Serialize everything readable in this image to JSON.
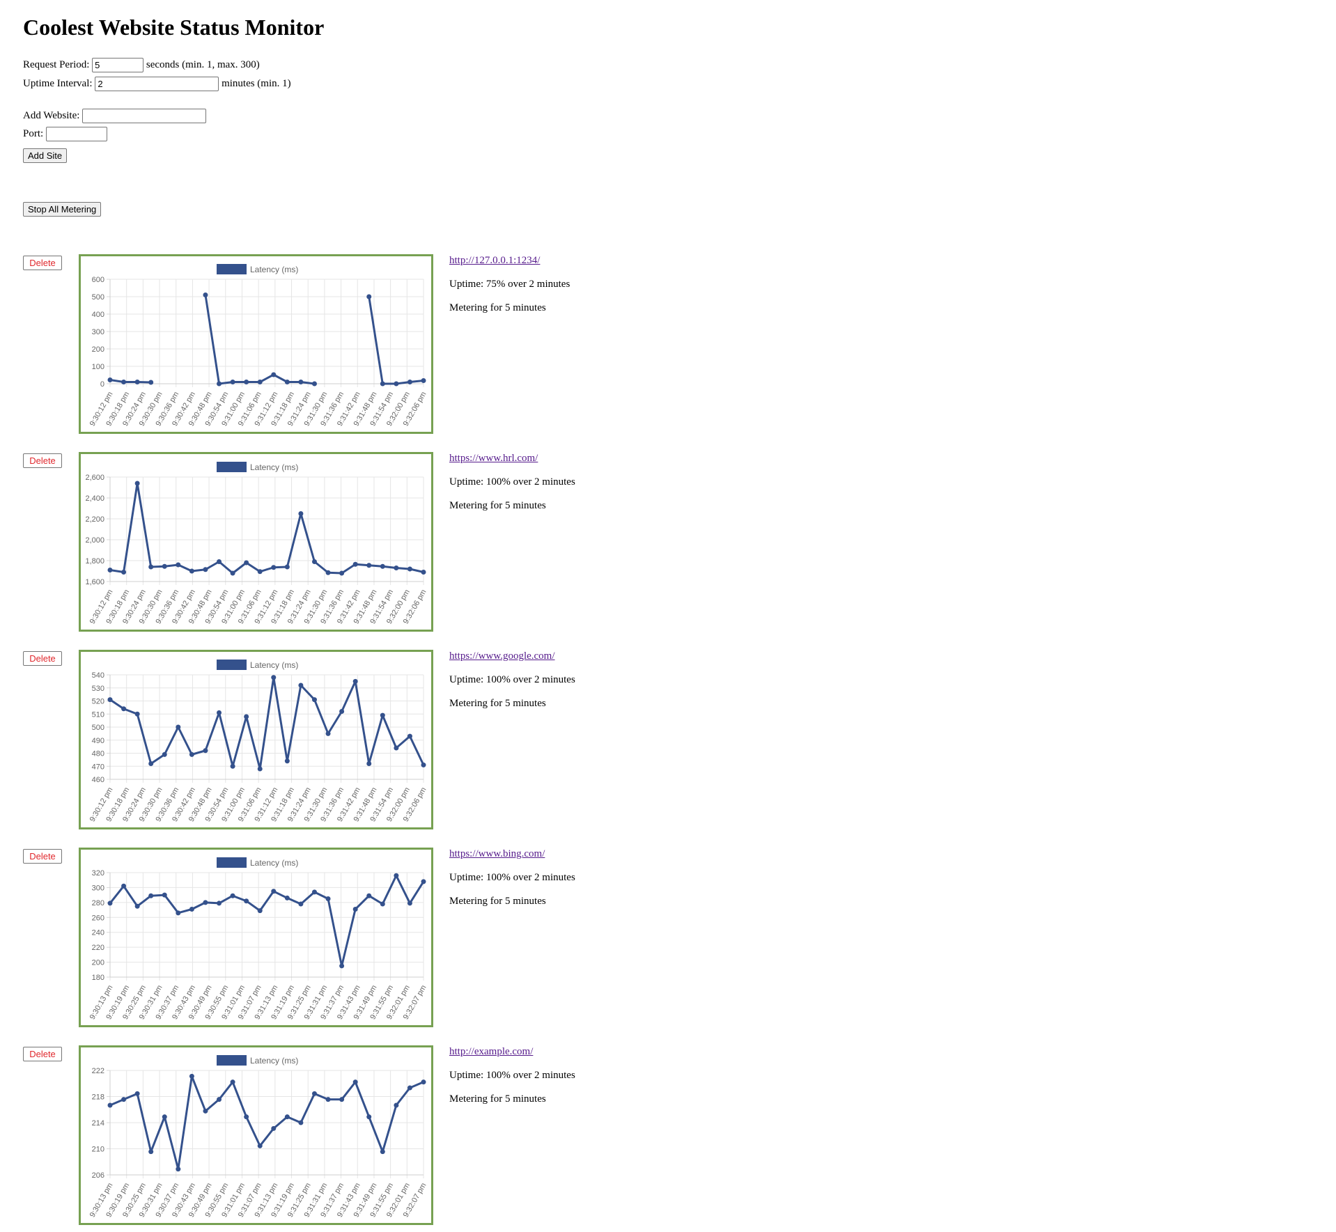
{
  "title": "Coolest Website Status Monitor",
  "settings": {
    "request_period_label": "Request Period:",
    "request_period_value": "5",
    "request_period_suffix": "seconds (min. 1, max. 300)",
    "uptime_interval_label": "Uptime Interval:",
    "uptime_interval_value": "2",
    "uptime_interval_suffix": "minutes (min. 1)"
  },
  "add_form": {
    "website_label": "Add Website:",
    "website_value": "",
    "port_label": "Port:",
    "port_value": "",
    "add_button": "Add Site"
  },
  "stop_button": "Stop All Metering",
  "colors": {
    "series": "#34518c",
    "chart_border": "#77a152",
    "delete_text": "#e0272c",
    "link": "#551a8b"
  },
  "sites": [
    {
      "delete_label": "Delete",
      "url": "http://127.0.0.1:1234/",
      "uptime": "Uptime: 75% over 2 minutes",
      "metering": "Metering for 5 minutes"
    },
    {
      "delete_label": "Delete",
      "url": "https://www.hrl.com/",
      "uptime": "Uptime: 100% over 2 minutes",
      "metering": "Metering for 5 minutes"
    },
    {
      "delete_label": "Delete",
      "url": "https://www.google.com/",
      "uptime": "Uptime: 100% over 2 minutes",
      "metering": "Metering for 5 minutes"
    },
    {
      "delete_label": "Delete",
      "url": "https://www.bing.com/",
      "uptime": "Uptime: 100% over 2 minutes",
      "metering": "Metering for 5 minutes"
    },
    {
      "delete_label": "Delete",
      "url": "http://example.com/",
      "uptime": "Uptime: 100% over 2 minutes",
      "metering": "Metering for 5 minutes"
    }
  ],
  "chart_data": [
    {
      "type": "line",
      "legend": [
        "Latency (ms)"
      ],
      "ylim": [
        0,
        600
      ],
      "yticks": [
        "600",
        "500",
        "400",
        "300",
        "200",
        "100",
        "0"
      ],
      "categories": [
        "9:30:12 pm",
        "9:30:18 pm",
        "9:30:24 pm",
        "9:30:30 pm",
        "9:30:36 pm",
        "9:30:42 pm",
        "9:30:48 pm",
        "9:30:54 pm",
        "9:31:00 pm",
        "9:31:06 pm",
        "9:31:12 pm",
        "9:31:18 pm",
        "9:31:24 pm",
        "9:31:30 pm",
        "9:31:36 pm",
        "9:31:42 pm",
        "9:31:48 pm",
        "9:31:54 pm",
        "9:32:00 pm",
        "9:32:06 pm"
      ],
      "values": [
        22,
        10,
        10,
        8,
        null,
        null,
        null,
        510,
        0,
        10,
        10,
        10,
        52,
        10,
        10,
        0,
        null,
        null,
        null,
        500,
        0,
        0,
        10,
        18
      ],
      "series": [
        {
          "name": "Latency (ms)",
          "values": [
            22,
            10,
            10,
            8,
            null,
            null,
            null,
            510,
            0,
            10,
            10,
            10,
            52,
            10,
            10,
            0,
            null,
            null,
            null,
            500,
            0,
            0,
            10,
            18
          ]
        }
      ]
    },
    {
      "type": "line",
      "legend": [
        "Latency (ms)"
      ],
      "ylim": [
        1600,
        2600
      ],
      "yticks": [
        "2,600",
        "2,400",
        "2,200",
        "2,000",
        "1,800",
        "1,600"
      ],
      "categories": [
        "9:30:12 pm",
        "9:30:18 pm",
        "9:30:24 pm",
        "9:30:30 pm",
        "9:30:36 pm",
        "9:30:42 pm",
        "9:30:48 pm",
        "9:30:54 pm",
        "9:31:00 pm",
        "9:31:06 pm",
        "9:31:12 pm",
        "9:31:18 pm",
        "9:31:24 pm",
        "9:31:30 pm",
        "9:31:36 pm",
        "9:31:42 pm",
        "9:31:48 pm",
        "9:31:54 pm",
        "9:32:00 pm",
        "9:32:06 pm"
      ],
      "values": [
        1710,
        1690,
        2540,
        1740,
        1745,
        1760,
        1700,
        1715,
        1790,
        1680,
        1780,
        1695,
        1735,
        1740,
        2250,
        1790,
        1685,
        1680,
        1765,
        1755,
        1745,
        1730,
        1720,
        1690
      ],
      "series": [
        {
          "name": "Latency (ms)",
          "values": [
            1710,
            1690,
            2540,
            1740,
            1745,
            1760,
            1700,
            1715,
            1790,
            1680,
            1780,
            1695,
            1735,
            1740,
            2250,
            1790,
            1685,
            1680,
            1765,
            1755,
            1745,
            1730,
            1720,
            1690
          ]
        }
      ]
    },
    {
      "type": "line",
      "legend": [
        "Latency (ms)"
      ],
      "ylim": [
        460,
        540
      ],
      "yticks": [
        "540",
        "530",
        "520",
        "510",
        "500",
        "490",
        "480",
        "470",
        "460"
      ],
      "categories": [
        "9:30:12 pm",
        "9:30:18 pm",
        "9:30:24 pm",
        "9:30:30 pm",
        "9:30:36 pm",
        "9:30:42 pm",
        "9:30:48 pm",
        "9:30:54 pm",
        "9:31:00 pm",
        "9:31:06 pm",
        "9:31:12 pm",
        "9:31:18 pm",
        "9:31:24 pm",
        "9:31:30 pm",
        "9:31:36 pm",
        "9:31:42 pm",
        "9:31:48 pm",
        "9:31:54 pm",
        "9:32:00 pm",
        "9:32:06 pm"
      ],
      "values": [
        521,
        514,
        510,
        472,
        479,
        500,
        479,
        482,
        511,
        470,
        508,
        468,
        538,
        474,
        532,
        521,
        495,
        512,
        535,
        472,
        509,
        484,
        493,
        471
      ],
      "series": [
        {
          "name": "Latency (ms)",
          "values": [
            521,
            514,
            510,
            472,
            479,
            500,
            479,
            482,
            511,
            470,
            508,
            468,
            538,
            474,
            532,
            521,
            495,
            512,
            535,
            472,
            509,
            484,
            493,
            471
          ]
        }
      ]
    },
    {
      "type": "line",
      "legend": [
        "Latency (ms)"
      ],
      "ylim": [
        180,
        320
      ],
      "yticks": [
        "320",
        "300",
        "280",
        "260",
        "240",
        "220",
        "200",
        "180"
      ],
      "categories": [
        "9:30:13 pm",
        "9:30:19 pm",
        "9:30:25 pm",
        "9:30:31 pm",
        "9:30:37 pm",
        "9:30:43 pm",
        "9:30:49 pm",
        "9:30:55 pm",
        "9:31:01 pm",
        "9:31:07 pm",
        "9:31:13 pm",
        "9:31:19 pm",
        "9:31:25 pm",
        "9:31:31 pm",
        "9:31:37 pm",
        "9:31:43 pm",
        "9:31:49 pm",
        "9:31:55 pm",
        "9:32:01 pm",
        "9:32:07 pm"
      ],
      "values": [
        279,
        302,
        275,
        289,
        290,
        266,
        271,
        280,
        279,
        289,
        282,
        269,
        295,
        286,
        278,
        294,
        285,
        195,
        271,
        289,
        278,
        316,
        279,
        308
      ],
      "series": [
        {
          "name": "Latency (ms)",
          "values": [
            279,
            302,
            275,
            289,
            290,
            266,
            271,
            280,
            279,
            289,
            282,
            269,
            295,
            286,
            278,
            294,
            285,
            195,
            271,
            289,
            278,
            316,
            279,
            308
          ]
        }
      ]
    },
    {
      "type": "line",
      "legend": [
        "Latency (ms)"
      ],
      "ylim": [
        206,
        224
      ],
      "yticks": [
        "222",
        "218",
        "214",
        "210",
        "206"
      ],
      "categories": [
        "9:30:13 pm",
        "9:30:19 pm",
        "9:30:25 pm",
        "9:30:31 pm",
        "9:30:37 pm",
        "9:30:43 pm",
        "9:30:49 pm",
        "9:30:55 pm",
        "9:31:01 pm",
        "9:31:07 pm",
        "9:31:13 pm",
        "9:31:19 pm",
        "9:31:25 pm",
        "9:31:31 pm",
        "9:31:37 pm",
        "9:31:43 pm",
        "9:31:49 pm",
        "9:31:55 pm",
        "9:32:01 pm",
        "9:32:07 pm"
      ],
      "values": [
        218,
        219,
        220,
        210,
        216,
        207,
        223,
        217,
        219,
        222,
        216,
        211,
        214,
        216,
        215,
        220,
        219,
        219,
        222,
        216,
        210,
        218,
        221,
        222
      ],
      "series": [
        {
          "name": "Latency (ms)",
          "values": [
            218,
            219,
            220,
            210,
            216,
            207,
            223,
            217,
            219,
            222,
            216,
            211,
            214,
            216,
            215,
            220,
            219,
            219,
            222,
            216,
            210,
            218,
            221,
            222
          ]
        }
      ]
    }
  ]
}
